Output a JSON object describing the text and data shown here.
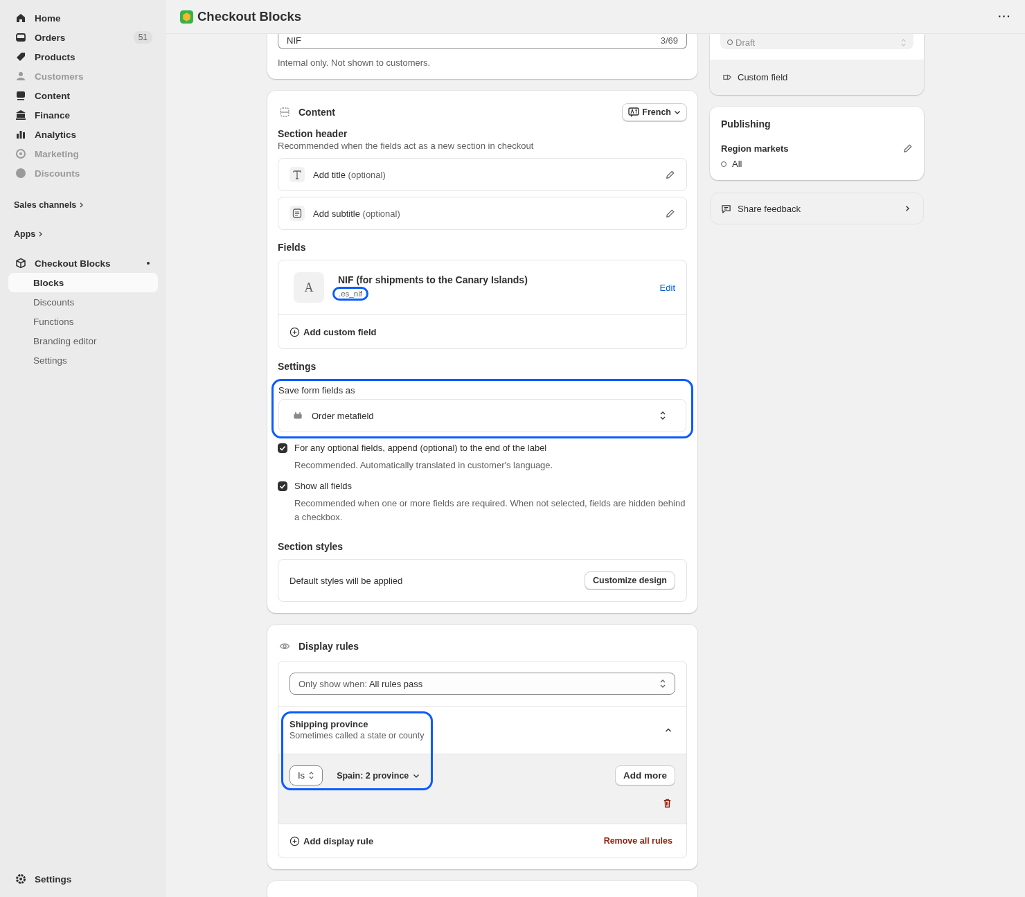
{
  "sidebar": {
    "items": [
      {
        "label": "Home",
        "disabled": false
      },
      {
        "label": "Orders",
        "disabled": false,
        "badge": "51"
      },
      {
        "label": "Products",
        "disabled": false
      },
      {
        "label": "Customers",
        "disabled": true
      },
      {
        "label": "Content",
        "disabled": false
      },
      {
        "label": "Finance",
        "disabled": false
      },
      {
        "label": "Analytics",
        "disabled": false
      },
      {
        "label": "Marketing",
        "disabled": true
      },
      {
        "label": "Discounts",
        "disabled": true
      }
    ],
    "sales_channels": "Sales channels",
    "apps": "Apps",
    "app": {
      "label": "Checkout Blocks",
      "children": [
        {
          "label": "Blocks",
          "selected": true
        },
        {
          "label": "Discounts",
          "selected": false
        },
        {
          "label": "Functions",
          "selected": false
        },
        {
          "label": "Branding editor",
          "selected": false
        },
        {
          "label": "Settings",
          "selected": false
        }
      ]
    },
    "settings": "Settings"
  },
  "header": {
    "title": "Checkout Blocks",
    "more": "···"
  },
  "name_card": {
    "value": "NIF",
    "counter": "3/69",
    "help": "Internal only. Not shown to customers."
  },
  "content_card": {
    "title": "Content",
    "language": "French",
    "section_header": {
      "title": "Section header",
      "description": "Recommended when the fields act as a new section in checkout",
      "rows": [
        {
          "label": "Add title",
          "hint": "(optional)"
        },
        {
          "label": "Add subtitle",
          "hint": "(optional)"
        }
      ]
    },
    "fields": {
      "title": "Fields",
      "items": [
        {
          "avatar": "A",
          "name": "NIF (for shipments to the Canary Islands)",
          "key": ".es_nif",
          "action": "Edit",
          "highlighted": true
        }
      ],
      "add": "Add custom field"
    },
    "settings": {
      "title": "Settings",
      "save_label": "Save form fields as",
      "save_value": "Order metafield",
      "highlighted": true,
      "checkboxes": [
        {
          "label": "For any optional fields, append (optional) to the end of the label",
          "help": "Recommended. Automatically translated in customer's language.",
          "checked": true
        },
        {
          "label": "Show all fields",
          "help": "Recommended when one or more fields are required. When not selected, fields are hidden behind a checkbox.",
          "checked": true
        }
      ]
    },
    "section_styles": {
      "title": "Section styles",
      "text": "Default styles will be applied",
      "button": "Customize design"
    }
  },
  "display_rules": {
    "title": "Display rules",
    "condition_label": "Only show when:",
    "condition_value": "All rules pass",
    "rules": [
      {
        "title": "Shipping province",
        "description": "Sometimes called a state or county",
        "expanded": true,
        "highlighted": true,
        "operator": "Is",
        "value": "Spain: 2 province",
        "add_more": "Add more"
      }
    ],
    "add": "Add display rule",
    "remove": "Remove all rules"
  },
  "status_card": {
    "status": "Draft",
    "disabled": true,
    "type": "Custom field"
  },
  "publishing": {
    "title": "Publishing",
    "label": "Region markets",
    "value": "All"
  },
  "feedback": {
    "label": "Share feedback"
  }
}
